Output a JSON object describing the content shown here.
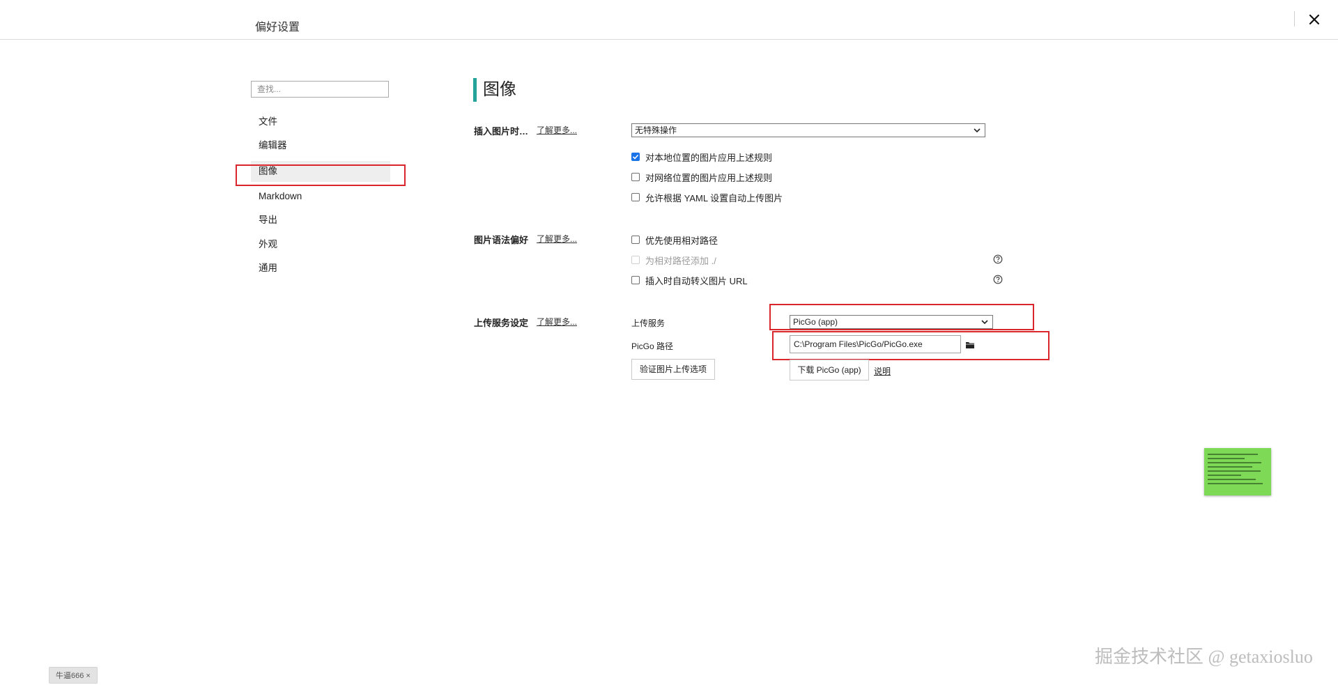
{
  "window": {
    "title": "偏好设置",
    "close_icon": "close-icon"
  },
  "sidebar": {
    "search_placeholder": "查找...",
    "items": [
      {
        "label": "文件"
      },
      {
        "label": "编辑器"
      },
      {
        "label": "图像",
        "active": true
      },
      {
        "label": "Markdown"
      },
      {
        "label": "导出"
      },
      {
        "label": "外观"
      },
      {
        "label": "通用"
      }
    ]
  },
  "main": {
    "section_title": "图像",
    "accent_color": "#23a39a",
    "insert_image": {
      "label": "插入图片时…",
      "learn_more": "了解更多...",
      "action_select": "无特殊操作",
      "options": [
        {
          "label": "对本地位置的图片应用上述规则",
          "checked": true
        },
        {
          "label": "对网络位置的图片应用上述规则",
          "checked": false
        },
        {
          "label": "允许根据 YAML 设置自动上传图片",
          "checked": false
        }
      ]
    },
    "syntax_pref": {
      "label": "图片语法偏好",
      "learn_more": "了解更多...",
      "options": [
        {
          "label": "优先使用相对路径",
          "checked": false,
          "disabled": false
        },
        {
          "label": "为相对路径添加 ./",
          "checked": false,
          "disabled": true
        },
        {
          "label": "插入时自动转义图片 URL",
          "checked": false,
          "disabled": false
        }
      ],
      "help_icon": "question-circle-icon"
    },
    "upload": {
      "label": "上传服务设定",
      "learn_more": "了解更多...",
      "service_label": "上传服务",
      "service_value": "PicGo (app)",
      "path_label": "PicGo 路径",
      "path_value": "C:\\Program Files\\PicGo/PicGo.exe",
      "folder_icon": "folder-icon",
      "verify_button": "验证图片上传选项",
      "download_button": "下载 PicGo (app)",
      "explain_link": "说明"
    }
  },
  "highlight_color": "#d9262c",
  "watermark": "掘金技术社区 @ getaxiosluo",
  "bottom_tag": "牛逼666 ×"
}
